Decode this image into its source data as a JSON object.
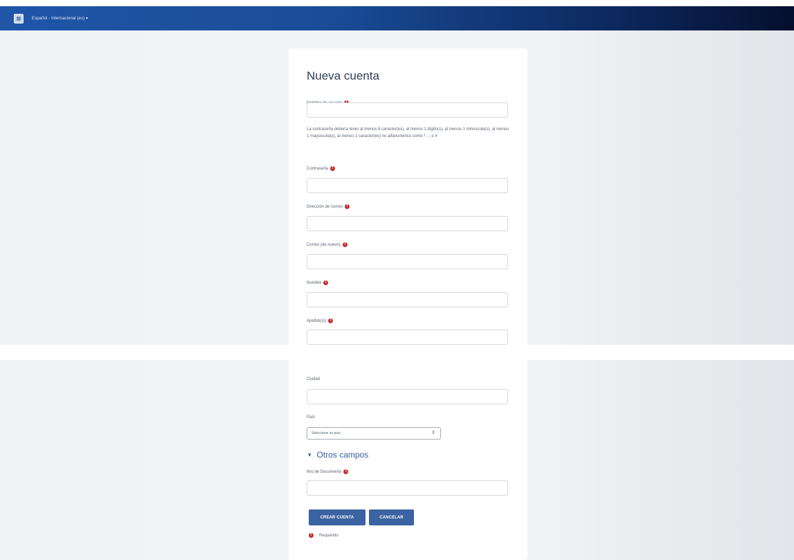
{
  "topbar": {
    "language": "Español - Internacional (es) ▾"
  },
  "page": {
    "title": "Nueva cuenta"
  },
  "fields": {
    "username": {
      "label": "Nombre de usuario"
    },
    "password_policy": "La contraseña debería tener al menos 8 caracter(es), al menos 1 dígito(s), al menos 1 minúscula(s), al menos 1 mayúscula(s), al menos 1 caracter(es) no alfanumérico como *, -, o #",
    "password": {
      "label": "Contraseña"
    },
    "email": {
      "label": "Dirección de correo"
    },
    "email_again": {
      "label": "Correo (de nuevo)"
    },
    "firstname": {
      "label": "Nombre"
    },
    "lastname": {
      "label": "Apellido(s)"
    },
    "city": {
      "label": "Ciudad"
    },
    "country": {
      "label": "País",
      "selected": "Seleccione su país"
    },
    "other_fields_section": "Otros campos",
    "document_number": {
      "label": "Nro de Documento"
    }
  },
  "actions": {
    "create": "CREAR CUENTA",
    "cancel": "CANCELAR"
  },
  "footer": {
    "required": "Requerido"
  },
  "colors": {
    "accent": "#3b62a1",
    "required": "#c4302b",
    "topbar": "#1f56a8"
  }
}
